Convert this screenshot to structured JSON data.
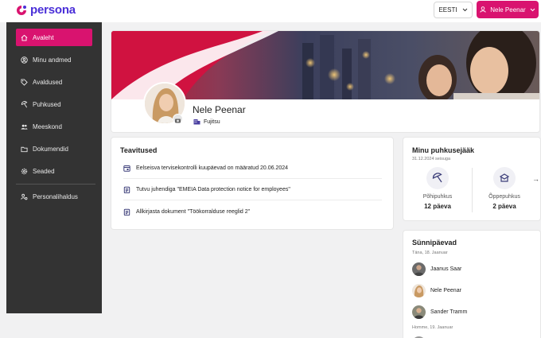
{
  "brand": {
    "name": "persona",
    "accent": "#d9136f",
    "logo_color": "#4a2fd8"
  },
  "header": {
    "language": "EESTI",
    "user_name": "Nele Peenar"
  },
  "sidebar": {
    "items": [
      {
        "label": "Avaleht",
        "icon": "home-icon",
        "active": true
      },
      {
        "label": "Minu andmed",
        "icon": "user-circle-icon",
        "active": false
      },
      {
        "label": "Avaldused",
        "icon": "tag-icon",
        "active": false
      },
      {
        "label": "Puhkused",
        "icon": "beach-umbrella-icon",
        "active": false
      },
      {
        "label": "Meeskond",
        "icon": "team-icon",
        "active": false
      },
      {
        "label": "Dokumendid",
        "icon": "folder-icon",
        "active": false
      },
      {
        "label": "Seaded",
        "icon": "gear-icon",
        "active": false
      },
      {
        "label": "Personalihaldus",
        "icon": "people-settings-icon",
        "active": false
      }
    ]
  },
  "profile": {
    "name": "Nele Peenar",
    "company": "Fujitsu"
  },
  "notifications": {
    "title": "Teavitused",
    "items": [
      {
        "icon": "calendar-icon",
        "text": "Eelseisva tervisekontrolli kuupäevad on määratud 20.06.2024"
      },
      {
        "icon": "clipboard-icon",
        "text": "Tutvu juhendiga \"EMEIA Data protection notice for employees\""
      },
      {
        "icon": "clipboard-icon",
        "text": "Allkirjasta dokument \"Töökorralduse reeglid 2\""
      }
    ]
  },
  "vacation": {
    "title": "Minu puhkusejääk",
    "as_of": "31.12.2024 seisuga",
    "items": [
      {
        "icon": "beach-umbrella-icon",
        "label": "Põhipuhkus",
        "value": "12 päeva"
      },
      {
        "icon": "study-icon",
        "label": "Õppepuhkus",
        "value": "2 päeva"
      }
    ]
  },
  "birthdays": {
    "title": "Sünnipäevad",
    "groups": [
      {
        "date": "Täna, 18. Jaanuar",
        "people": [
          "Jaanus Saar",
          "Nele Peenar",
          "Sander Tramm"
        ]
      },
      {
        "date": "Homme, 19. Jaanuar",
        "people": []
      }
    ]
  }
}
